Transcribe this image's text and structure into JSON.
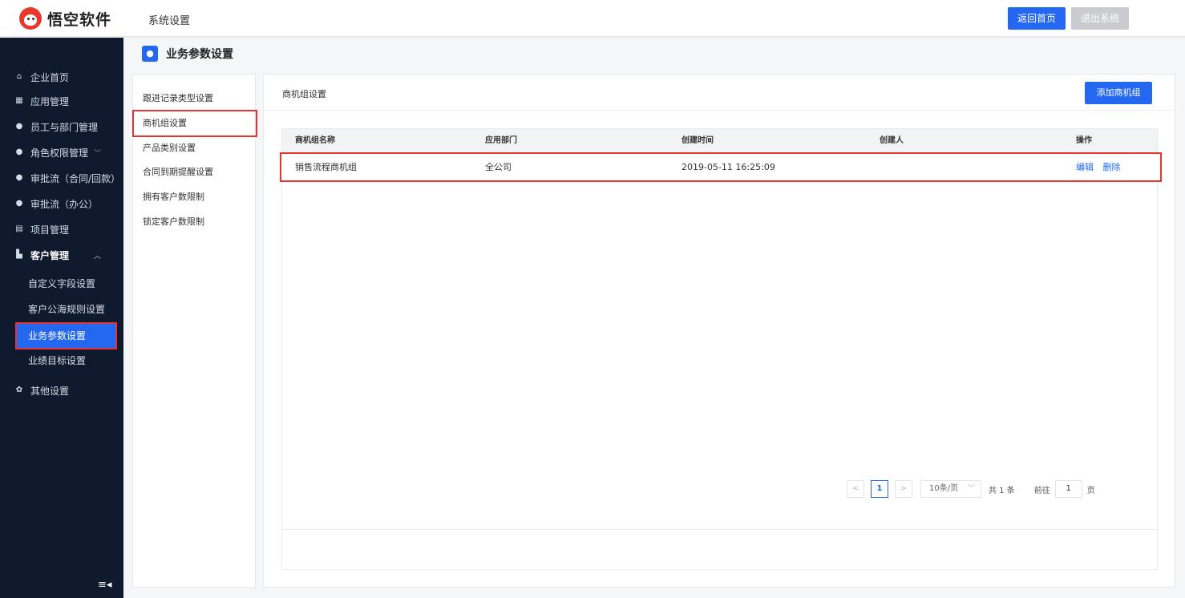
{
  "app": {
    "logo_text": "悟空软件",
    "title": "系统设置"
  },
  "header": {
    "home_label": "返回首页",
    "exit_label": "退出系统"
  },
  "sidebar": {
    "items": [
      {
        "label": "企业首页",
        "icon": "home-icon"
      },
      {
        "label": "应用管理",
        "icon": "grid-icon"
      },
      {
        "label": "员工与部门管理",
        "icon": "users-icon"
      },
      {
        "label": "角色权限管理",
        "icon": "user-icon",
        "arrow": "﹀"
      },
      {
        "label": "审批流（合同/回款）",
        "icon": "user-icon"
      },
      {
        "label": "审批流（办公）",
        "icon": "user-icon"
      },
      {
        "label": "项目管理",
        "icon": "project-icon"
      },
      {
        "label": "客户管理",
        "icon": "building-icon",
        "arrow": "︿"
      },
      {
        "label": "其他设置",
        "icon": "gear-icon"
      }
    ],
    "sub_items": [
      "自定义字段设置",
      "客户公海规则设置",
      "业务参数设置",
      "业绩目标设置"
    ],
    "collapse_glyph": "≡◂"
  },
  "page": {
    "title": "业务参数设置"
  },
  "sub_menu": [
    "跟进记录类型设置",
    "商机组设置",
    "产品类别设置",
    "合同到期提醒设置",
    "拥有客户数限制",
    "锁定客户数限制"
  ],
  "main": {
    "title": "商机组设置",
    "add_label": "添加商机组",
    "columns": [
      "商机组名称",
      "应用部门",
      "创建时间",
      "创建人",
      "操作"
    ],
    "rows": [
      {
        "name": "销售流程商机组",
        "dept": "全公司",
        "time": "2019-05-11 16:25:09",
        "creator": "",
        "edit": "编辑",
        "delete": "删除"
      }
    ]
  },
  "pager": {
    "prev": "<",
    "current": "1",
    "next": ">",
    "page_size": "10条/页",
    "total": "共 1 条",
    "goto_label": "前往",
    "goto_value": "1",
    "page_unit": "页"
  },
  "colors": {
    "accent": "#2468f2",
    "sidebar_bg": "#0f1a2e",
    "highlight": "#e8332e"
  }
}
